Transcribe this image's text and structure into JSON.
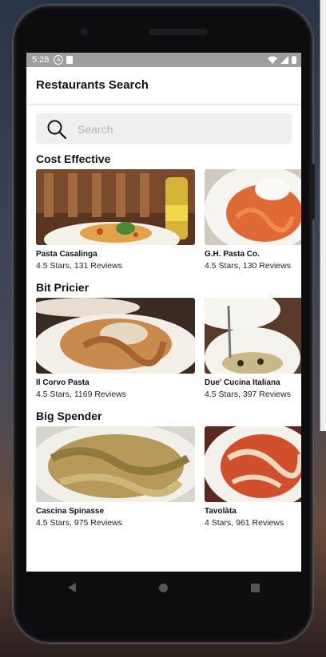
{
  "status_bar": {
    "time": "5:28",
    "a_icon_letter": "A",
    "icons_left": [
      "a-icon",
      "sim-card-icon"
    ],
    "icons_right": [
      "wifi-icon",
      "signal-icon",
      "battery-icon"
    ]
  },
  "app": {
    "title": "Restaurants Search"
  },
  "search": {
    "placeholder": "Search",
    "value": "",
    "icon": "search-icon"
  },
  "sections": [
    {
      "title": "Cost Effective",
      "restaurants": [
        {
          "name": "Pasta Casalinga",
          "meta": "4.5 Stars, 131 Reviews"
        },
        {
          "name": "G.H. Pasta Co.",
          "meta": "4.5 Stars, 130 Reviews"
        }
      ]
    },
    {
      "title": "Bit Pricier",
      "restaurants": [
        {
          "name": "Il Corvo Pasta",
          "meta": "4.5 Stars, 1169 Reviews"
        },
        {
          "name": "Due' Cucina Italiana",
          "meta": "4.5 Stars, 397 Reviews"
        }
      ]
    },
    {
      "title": "Big Spender",
      "restaurants": [
        {
          "name": "Cascina Spinasse",
          "meta": "4.5 Stars, 975 Reviews"
        },
        {
          "name": "Tavolàta",
          "meta": "4 Stars, 961 Reviews"
        }
      ]
    }
  ],
  "nav": {
    "icons": [
      "back-icon",
      "home-icon",
      "recents-icon"
    ]
  },
  "colors": {
    "status_bar": "#9e9e9e",
    "search_bg": "#efefef",
    "text": "#111111"
  }
}
